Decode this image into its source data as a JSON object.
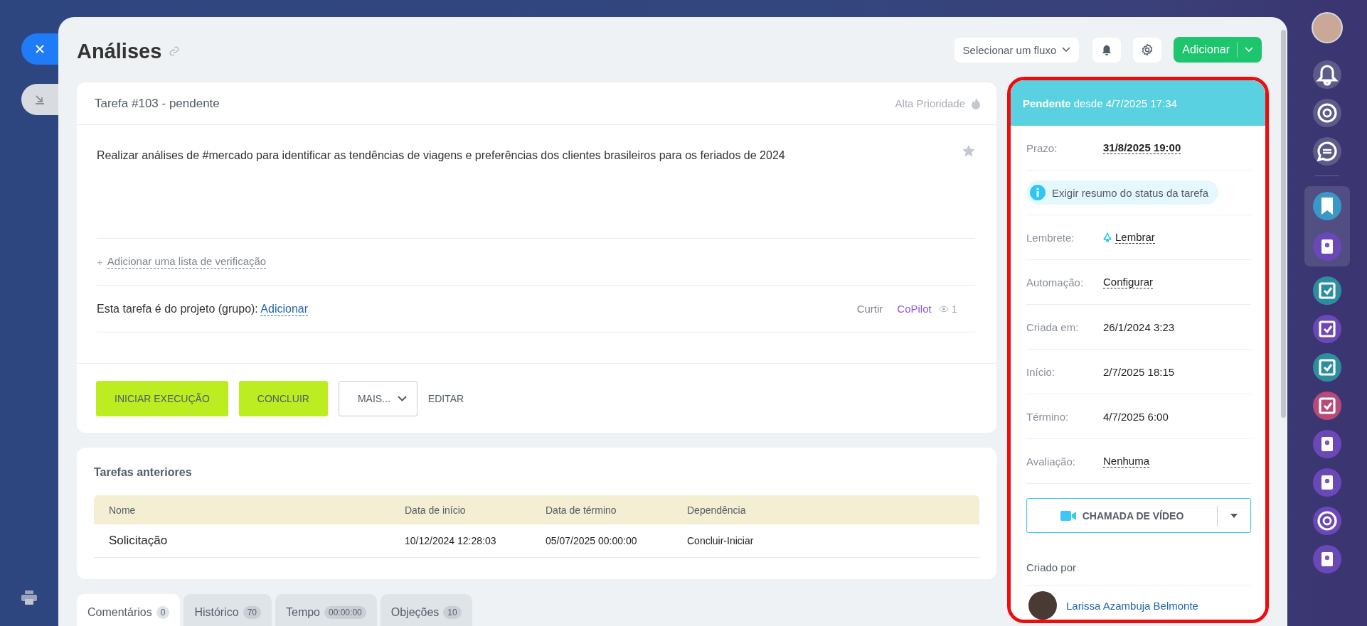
{
  "header": {
    "title": "Análises",
    "flow_select": "Selecionar um fluxo",
    "add_button": "Adicionar"
  },
  "task": {
    "title": "Tarefa #103 - pendente",
    "priority": "Alta Prioridade",
    "starred": false,
    "description": "Realizar análises de #mercado para identificar as tendências de viagens e preferências dos clientes brasileiros para os feriados de 2024",
    "checklist_plus": "+",
    "checklist_link": "Adicionar uma lista de verificação",
    "project_label": "Esta tarefa é do projeto (grupo):",
    "project_link": "Adicionar",
    "like": "Curtir",
    "copilot": "CoPilot",
    "views": "1"
  },
  "actions": [
    {
      "label": "INICIAR EXECUÇÃO",
      "kind": "primary"
    },
    {
      "label": "CONCLUIR",
      "kind": "primary"
    },
    {
      "label": "MAIS...",
      "kind": "dropdown"
    },
    {
      "label": "EDITAR",
      "kind": "link"
    }
  ],
  "previous_tasks": {
    "title": "Tarefas anteriores",
    "columns": [
      "Nome",
      "Data de início",
      "Data de término",
      "Dependência"
    ],
    "rows": [
      [
        "Solicitação",
        "10/12/2024 12:28:03",
        "05/07/2025 00:00:00",
        "Concluir-Iniciar"
      ]
    ]
  },
  "tabs": [
    {
      "label": "Comentários",
      "count": "0",
      "selected": true
    },
    {
      "label": "Histórico",
      "count": "70",
      "selected": false
    },
    {
      "label": "Tempo",
      "count": "00:00:00",
      "selected": false
    },
    {
      "label": "Objeções",
      "count": "10",
      "selected": false
    }
  ],
  "status_panel": {
    "status": "Pendente",
    "since": "desde 4/7/2025 17:34",
    "fields": [
      {
        "kind": "deadline",
        "label": "Prazo:",
        "value": "31/8/2025 19:00"
      },
      {
        "kind": "notice",
        "value": "Exigir resumo do status da tarefa"
      },
      {
        "kind": "reminder",
        "label": "Lembrete:",
        "value": "Lembrar"
      },
      {
        "kind": "link",
        "label": "Automação:",
        "value": "Configurar"
      },
      {
        "kind": "text",
        "label": "Criada em:",
        "value": "26/1/2024 3:23"
      },
      {
        "kind": "text",
        "label": "Início:",
        "value": "2/7/2025 18:15"
      },
      {
        "kind": "text",
        "label": "Término:",
        "value": "4/7/2025 6:00"
      },
      {
        "kind": "link",
        "label": "Avaliação:",
        "value": "Nenhuma"
      }
    ],
    "video_call": "CHAMADA DE VÍDEO",
    "created_by_label": "Criado por",
    "creator": "Larissa Azambuja Belmonte"
  }
}
